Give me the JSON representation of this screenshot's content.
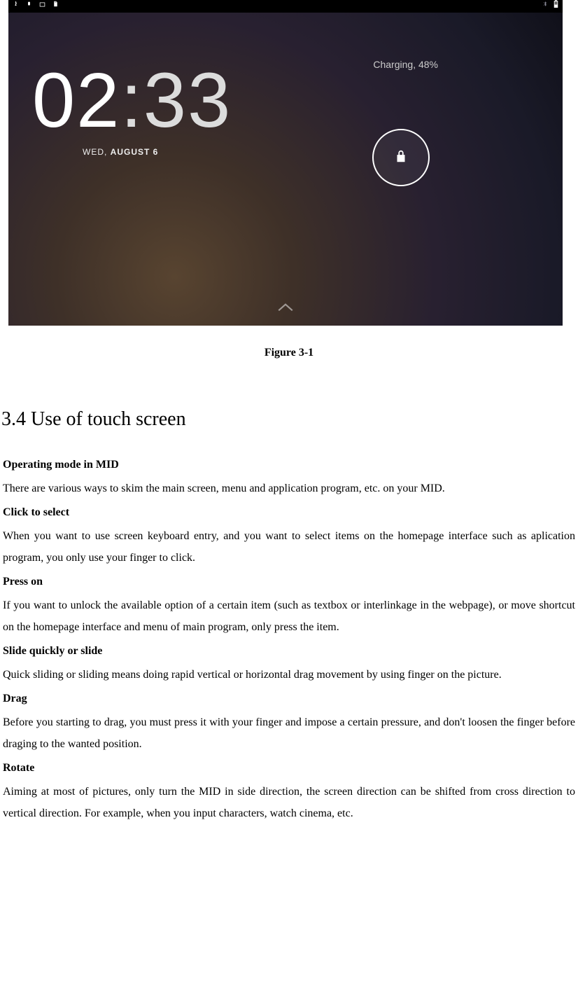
{
  "screenshot": {
    "charging": "Charging, 48%",
    "hours": "02",
    "colon": ":",
    "minutes": "33",
    "date_day": "WED, ",
    "date_rest": "AUGUST 6"
  },
  "caption": "Figure 3-1",
  "section_title": "3.4 Use of touch screen",
  "sections": {
    "intro_head": "Operating mode in MID",
    "intro_body": "There are various ways to skim the main screen, menu and application program, etc. on your MID.",
    "click_head": "Click to select",
    "click_body": "When you want to use screen keyboard entry, and you want to select items on the homepage interface such as aplication program, you only use your finger to click.",
    "press_head": "Press on",
    "press_body": "If you want to unlock the available option of a certain item (such as textbox or interlinkage in the webpage), or move shortcut on the homepage interface and menu of main program, only press the item.",
    "slide_head": "Slide quickly or slide",
    "slide_body": "Quick sliding or sliding means doing rapid vertical or horizontal drag movement by using finger on the picture.",
    "drag_head": "Drag",
    "drag_body": "Before you starting to drag, you must press it with your finger and impose a certain pressure, and don't loosen the finger before draging to the wanted position.",
    "rotate_head": "Rotate",
    "rotate_body": "Aiming at most of pictures, only turn the MID in side direction, the screen direction can be shifted from cross direction to vertical direction. For example, when you input characters, watch cinema, etc."
  }
}
